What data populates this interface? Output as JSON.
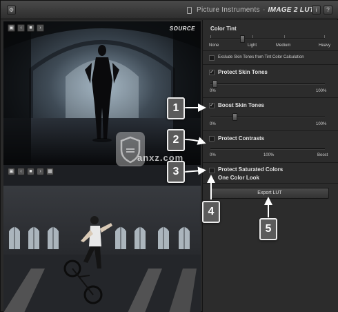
{
  "titlebar": {
    "settings_icon": "gear-icon",
    "brand": "Picture Instruments",
    "separator": "-",
    "product": "IMAGE 2 LUT",
    "info_label": "i",
    "help_label": "?"
  },
  "source_panel": {
    "label": "SOURCE",
    "toolbar_icons": [
      "save-icon",
      "back-icon",
      "folder-icon",
      "forward-icon"
    ]
  },
  "target_panel": {
    "toolbar_icons": [
      "save-icon",
      "back-icon",
      "folder-icon",
      "forward-icon",
      "calendar-icon"
    ]
  },
  "controls": {
    "color_tint": {
      "title": "Color Tint",
      "scale": [
        "None",
        "Light",
        "Medium",
        "Heavy"
      ],
      "value_fraction": 0.27
    },
    "exclude_skin": {
      "label": "Exclude Skin Tones from Tint Color Calculation",
      "checked": false
    },
    "protect_skin": {
      "label": "Protect Skin Tones",
      "checked": true,
      "min": "0%",
      "max": "100%",
      "value_fraction": 0.02
    },
    "boost_skin": {
      "label": "Boost Skin Tones",
      "checked": true,
      "min": "0%",
      "max": "100%",
      "value_fraction": 0.2
    },
    "protect_contrasts": {
      "label": "Protect Contrasts",
      "checked": false,
      "min": "0%",
      "mid": "100%",
      "max": "Boost"
    },
    "protect_saturated": {
      "label": "Protect Saturated Colors",
      "checked": false
    },
    "one_color": {
      "label": "One Color Look"
    },
    "export_label": "Export LUT"
  },
  "callouts": [
    "1",
    "2",
    "3",
    "4",
    "5"
  ],
  "watermark": {
    "text": "anxz.com"
  }
}
